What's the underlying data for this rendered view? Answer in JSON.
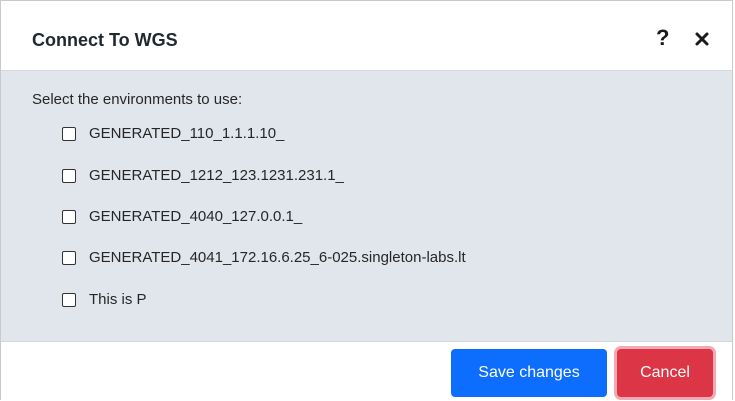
{
  "dialog": {
    "title": "Connect To WGS",
    "help_icon": "?",
    "close_icon": "close-icon"
  },
  "body": {
    "prompt": "Select the environments to use:",
    "options": [
      {
        "label": "GENERATED_110_1.1.1.10_",
        "checked": false
      },
      {
        "label": "GENERATED_1212_123.1231.231.1_",
        "checked": false
      },
      {
        "label": "GENERATED_4040_127.0.0.1_",
        "checked": false
      },
      {
        "label": "GENERATED_4041_172.16.6.25_6-025.singleton-labs.lt",
        "checked": false
      },
      {
        "label": "This is P",
        "checked": false
      }
    ]
  },
  "footer": {
    "save_label": "Save changes",
    "cancel_label": "Cancel"
  },
  "colors": {
    "body_bg": "#e1e6ed",
    "primary": "#0d6efd",
    "danger": "#dc3545"
  }
}
